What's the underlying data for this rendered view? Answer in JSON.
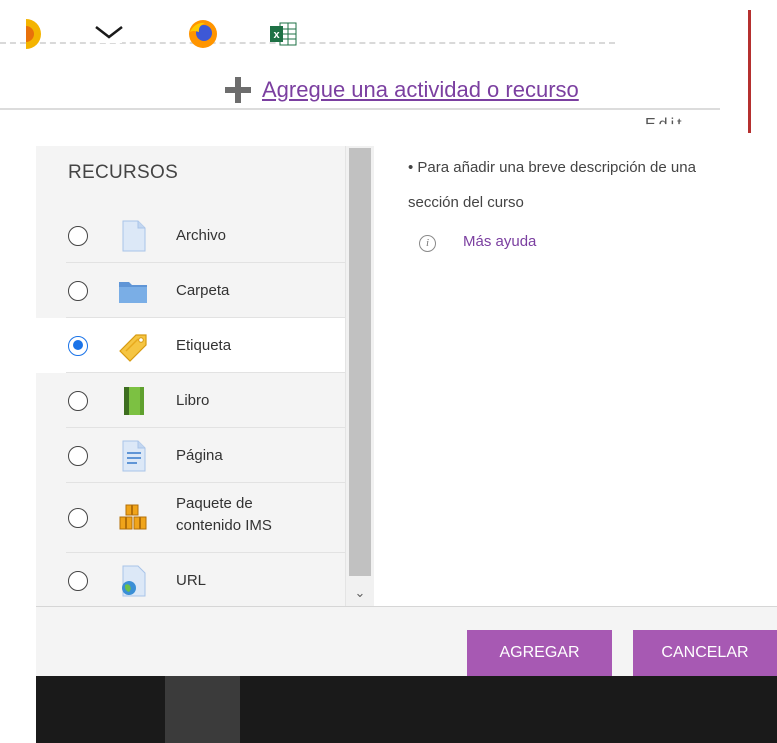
{
  "page": {
    "add_activity_link": "Agregue una actividad o recurso",
    "partial_text": "Edit"
  },
  "chooser": {
    "section_title": "RECURSOS",
    "items": [
      {
        "label": "Archivo",
        "icon": "file-icon",
        "selected": false
      },
      {
        "label": "Carpeta",
        "icon": "folder-icon",
        "selected": false
      },
      {
        "label": "Etiqueta",
        "icon": "label-tag-icon",
        "selected": true
      },
      {
        "label": "Libro",
        "icon": "book-icon",
        "selected": false
      },
      {
        "label": "Página",
        "icon": "page-icon",
        "selected": false
      },
      {
        "label": "Paquete de contenido IMS",
        "label_line1": "Paquete de",
        "label_line2": "contenido IMS",
        "icon": "ims-package-icon",
        "selected": false
      },
      {
        "label": "URL",
        "icon": "url-globe-icon",
        "selected": false
      }
    ],
    "help": {
      "bullet": "• Para añadir una breve descripción de una sección del curso",
      "more_help": "Más ayuda"
    },
    "buttons": {
      "add": "AGREGAR",
      "cancel": "CANCELAR"
    }
  },
  "taskbar": {
    "icons": [
      "chrome-icon",
      "mail-icon",
      "firefox-icon",
      "excel-icon"
    ]
  },
  "colors": {
    "accent": "#a759b3",
    "link": "#7b3fa0",
    "radio_selected": "#1a73e8"
  }
}
